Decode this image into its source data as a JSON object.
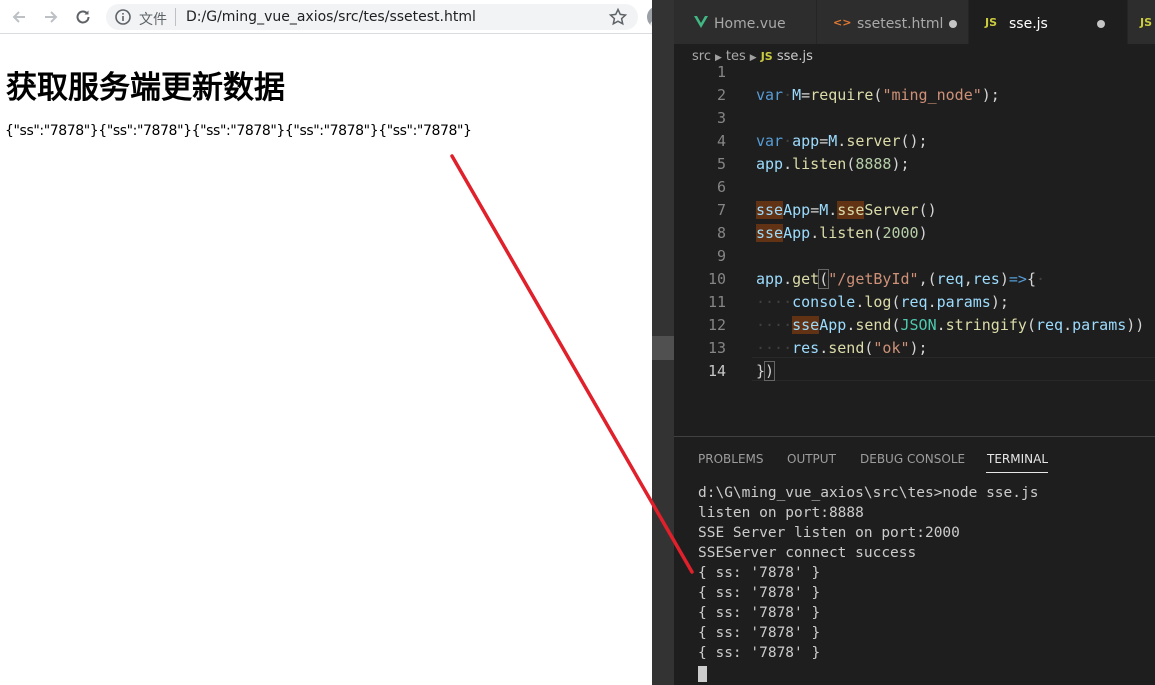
{
  "browser": {
    "file_label": "文件",
    "url": "D:/G/ming_vue_axios/src/tes/ssetest.html",
    "page_heading": "获取服务端更新数据",
    "page_output": "{\"ss\":\"7878\"}{\"ss\":\"7878\"}{\"ss\":\"7878\"}{\"ss\":\"7878\"}{\"ss\":\"7878\"}"
  },
  "editor": {
    "tabs": [
      {
        "icon": "V",
        "label": "Home.vue"
      },
      {
        "icon": "<>",
        "label": "ssetest.html"
      },
      {
        "icon": "JS",
        "label": "sse.js"
      },
      {
        "icon": "JS",
        "label": ""
      }
    ],
    "breadcrumb": {
      "folder1": "src",
      "folder2": "tes",
      "file_icon": "JS",
      "file": "sse.js"
    },
    "line_numbers": [
      "1",
      "2",
      "3",
      "4",
      "5",
      "6",
      "7",
      "8",
      "9",
      "10",
      "11",
      "12",
      "13",
      "14"
    ],
    "panel_tabs": [
      "PROBLEMS",
      "OUTPUT",
      "DEBUG CONSOLE",
      "TERMINAL"
    ],
    "terminal_lines": [
      "d:\\G\\ming_vue_axios\\src\\tes>node sse.js",
      "listen on port:8888",
      "SSE Server listen on port:2000",
      "SSEServer connect success",
      "{ ss: '7878' }",
      "{ ss: '7878' }",
      "{ ss: '7878' }",
      "{ ss: '7878' }",
      "{ ss: '7878' }"
    ]
  },
  "colors": {
    "annotation_arrow": "#e0202a",
    "editor_bg": "#1e1e1e",
    "keyword": "#569cd6",
    "string": "#ce9178"
  }
}
